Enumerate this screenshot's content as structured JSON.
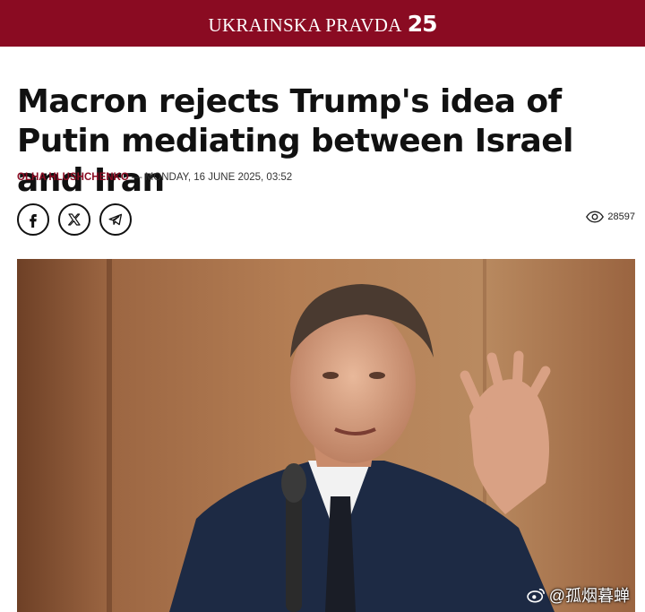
{
  "header": {
    "brand_name": "UKRAINSKA PRAVDA",
    "brand_number": "25",
    "background_color": "#8a0b22"
  },
  "article": {
    "headline": "Macron rejects Trump's idea of Putin mediating between Israel and Iran",
    "author": "OLHA HLUSHCHENKO",
    "separator": "—",
    "date": "MONDAY, 16 JUNE 2025, 03:52",
    "view_count": "28597"
  },
  "share": {
    "buttons": [
      {
        "icon": "facebook-icon"
      },
      {
        "icon": "x-icon"
      },
      {
        "icon": "telegram-icon"
      }
    ]
  },
  "image": {
    "subject": "photo"
  },
  "watermark": {
    "text": "@孤烟暮蝉",
    "icon": "weibo-icon"
  }
}
